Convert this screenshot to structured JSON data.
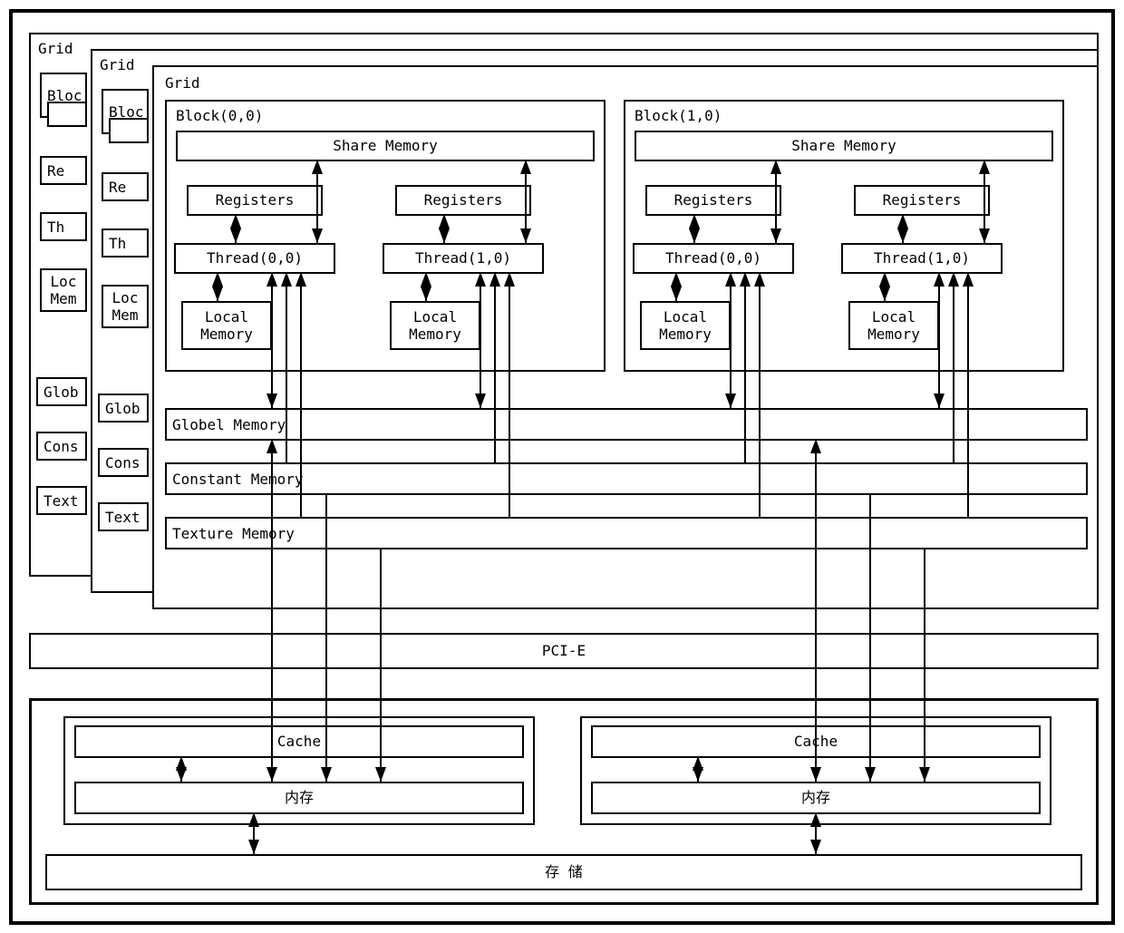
{
  "grid_label": "Grid",
  "block00_label": "Block(0,0)",
  "block10_label": "Block(1,0)",
  "share_memory": "Share Memory",
  "registers": "Registers",
  "thread00": "Thread(0,0)",
  "thread10": "Thread(1,0)",
  "local_memory": "Local\nMemory",
  "global_memory": "Globel Memory",
  "constant_memory": "Constant Memory",
  "texture_memory": "Texture Memory",
  "pcie": "PCI-E",
  "cache": "Cache",
  "ram": "内存",
  "storage": "存 储",
  "partial_block": "Bloc",
  "partial_registers": "Re",
  "partial_thread": "Th",
  "partial_local": "Loc\nMem",
  "partial_global": "Glob",
  "partial_constant": "Cons",
  "partial_texture": "Text",
  "partial_block2": "Bloc",
  "partial_registers2": "Re",
  "partial_thread2": "Th",
  "partial_local2": "Loc\nMem",
  "partial_global2": "Glob",
  "partial_constant2": "Cons",
  "partial_texture2": "Text"
}
